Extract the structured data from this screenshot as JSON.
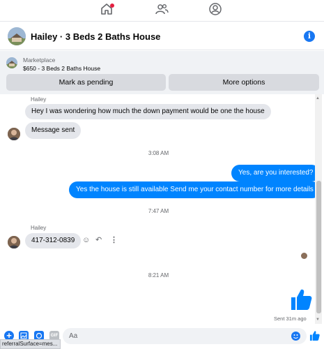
{
  "nav": {
    "icons": [
      "home-icon",
      "people-icon",
      "profile-icon"
    ]
  },
  "header": {
    "title": "Hailey · 3 Beds 2 Baths House",
    "info_glyph": "i"
  },
  "marketplace": {
    "label": "Marketplace",
    "listing": "$650 - 3 Beds 2 Baths House",
    "mark_pending": "Mark as pending",
    "more_options": "More options"
  },
  "thread": {
    "msg1_sender": "Hailey",
    "msg1_text": "Hey I was wondering how much the down payment would be one the house",
    "msg2_text": "Message sent",
    "time1": "3:08 AM",
    "out1": "Yes, are you interested?",
    "out2": "Yes the house is still available Send me your contact number for more details",
    "time2": "7:47 AM",
    "msg3_sender": "Hailey",
    "msg3_text": "417-312-0839",
    "time3": "8:21 AM",
    "sent_status": "Sent 31m ago"
  },
  "composer": {
    "placeholder": "Aa",
    "gif_label": "GIF"
  },
  "status_tip": "referralSurface=mes..."
}
